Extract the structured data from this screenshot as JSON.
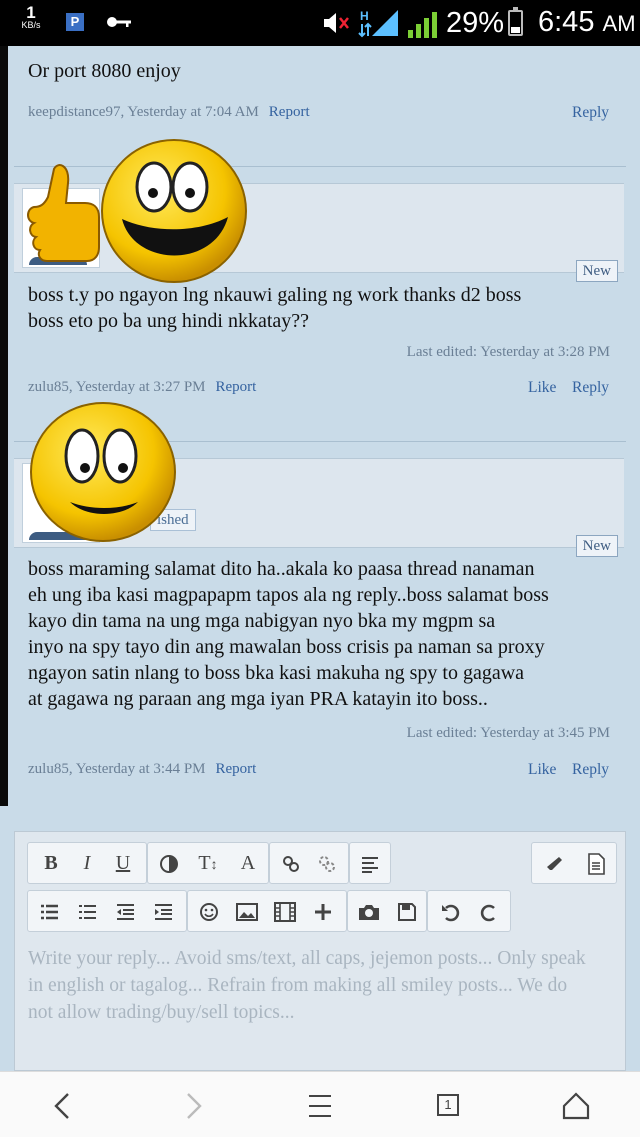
{
  "status_bar": {
    "net_speed_value": "1",
    "net_speed_unit": "KB/s",
    "notif_p": "P",
    "battery_pct": "29%",
    "time": "6:45",
    "ampm": "AM",
    "battery_level": 0.29
  },
  "posts": [
    {
      "text": "Or port 8080 enjoy",
      "meta": "keepdistance97, Yesterday at 7:04 AM",
      "report": "Report",
      "reply": "Reply"
    },
    {
      "badge": "New",
      "lines": [
        "boss t.y po ngayon lng nkauwi galing ng work thanks d2 boss",
        "boss eto po ba ung hindi nkkatay??"
      ],
      "edited": "Last edited: Yesterday at 3:28 PM",
      "meta": "zulu85, Yesterday at 3:27 PM",
      "report": "Report",
      "like": "Like",
      "reply": "Reply"
    },
    {
      "badge": "New",
      "banned_partial": "ished",
      "lines": [
        "boss maraming salamat dito ha..akala ko paasa thread nanaman",
        "eh ung iba kasi magpapapm tapos ala ng reply..boss salamat boss",
        "kayo din tama na ung mga nabigyan nyo bka my mgpm sa",
        "inyo na spy tayo din ang mawalan boss crisis pa naman sa proxy",
        "ngayon satin nlang to boss bka kasi makuha ng spy to gagawa",
        "at gagawa ng paraan ang mga iyan PRA katayin ito boss.."
      ],
      "edited": "Last edited: Yesterday at 3:45 PM",
      "meta": "zulu85, Yesterday at 3:44 PM",
      "report": "Report",
      "like": "Like",
      "reply": "Reply"
    }
  ],
  "editor": {
    "bold": "B",
    "italic": "I",
    "underline": "U",
    "fontsize": "T",
    "fontcolor": "A",
    "placeholder_lines": [
      "Write your reply... Avoid sms/text, all caps, jejemon posts... Only speak",
      "in english or tagalog... Refrain from making all smiley posts... We do",
      "not allow trading/buy/sell topics..."
    ]
  },
  "navbar": {
    "tabs_count": "1"
  },
  "colors": {
    "link": "#3563a0",
    "background": "#c9dbe8",
    "smiley": "#f3c400"
  }
}
